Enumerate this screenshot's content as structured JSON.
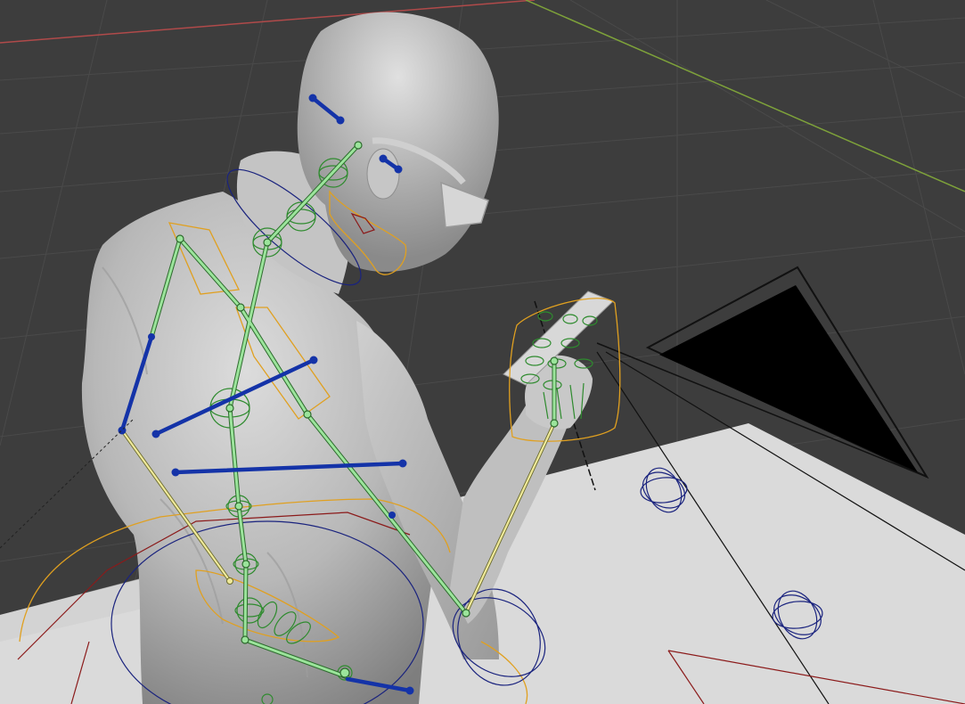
{
  "viewport": {
    "mode": "pose",
    "colors": {
      "background": "#3d3d3d",
      "grid": "#4a4a4a",
      "axis_x": "#b04a4a",
      "axis_y": "#7ea23a",
      "floor": "#dadada",
      "mesh": "#b7b7b7",
      "bone_selected": "#7fdc7f",
      "bone_active": "#e8e38a",
      "bone_ik": "#1433a8",
      "control_orange": "#e0a020",
      "control_green": "#2e8b2e",
      "control_red": "#8b1a1a",
      "control_blue": "#1a237e",
      "camera": "#111111"
    },
    "objects": [
      "armature",
      "character-mesh",
      "glasses",
      "phone",
      "camera",
      "floor-plane"
    ]
  }
}
